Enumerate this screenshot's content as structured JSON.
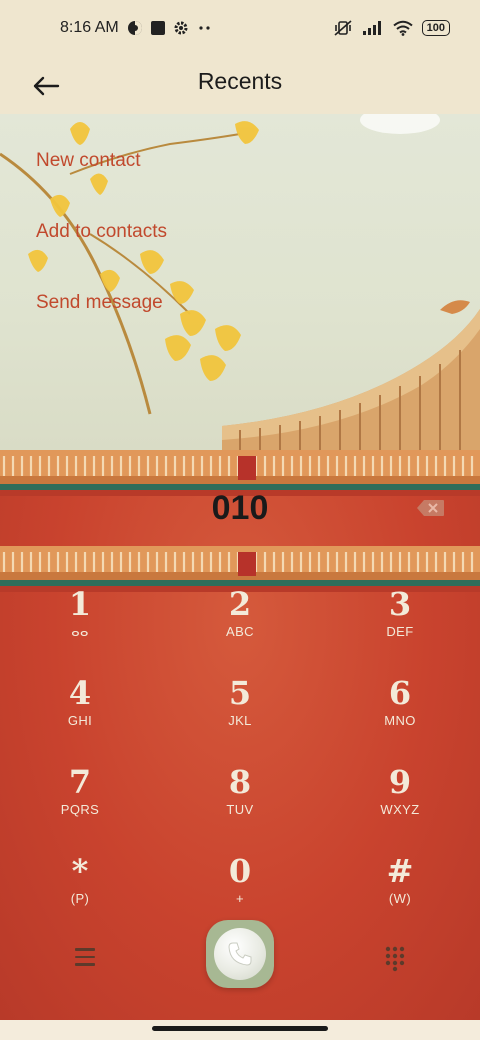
{
  "status_bar": {
    "time": "8:16 AM",
    "battery": "100",
    "icons": [
      "vpn-icon",
      "notification-square-icon",
      "settings-icon",
      "more-dots-icon",
      "mute-vibrate-icon",
      "signal-icon",
      "wifi-icon"
    ]
  },
  "app_bar": {
    "title": "Recents",
    "back_icon": "arrow-left-icon"
  },
  "actions": [
    {
      "label": "New contact"
    },
    {
      "label": "Add to contacts"
    },
    {
      "label": "Send message"
    }
  ],
  "dialed_number": "010",
  "keypad": [
    {
      "digit": "1",
      "letters": "ⴰⴰ"
    },
    {
      "digit": "2",
      "letters": "ABC"
    },
    {
      "digit": "3",
      "letters": "DEF"
    },
    {
      "digit": "4",
      "letters": "GHI"
    },
    {
      "digit": "5",
      "letters": "JKL"
    },
    {
      "digit": "6",
      "letters": "MNO"
    },
    {
      "digit": "7",
      "letters": "PQRS"
    },
    {
      "digit": "8",
      "letters": "TUV"
    },
    {
      "digit": "9",
      "letters": "WXYZ"
    },
    {
      "digit": "*",
      "letters": "(P)"
    },
    {
      "digit": "0",
      "letters": "+"
    },
    {
      "digit": "#",
      "letters": "(W)"
    }
  ],
  "bottom_bar": {
    "menu_icon": "menu-icon",
    "call_icon": "phone-icon",
    "dialpad_icon": "dialpad-icon"
  },
  "colors": {
    "accent_text": "#c1492d",
    "wall": "#c9432e",
    "call_button": "#a7b893",
    "header_bg": "#efe6cf"
  }
}
